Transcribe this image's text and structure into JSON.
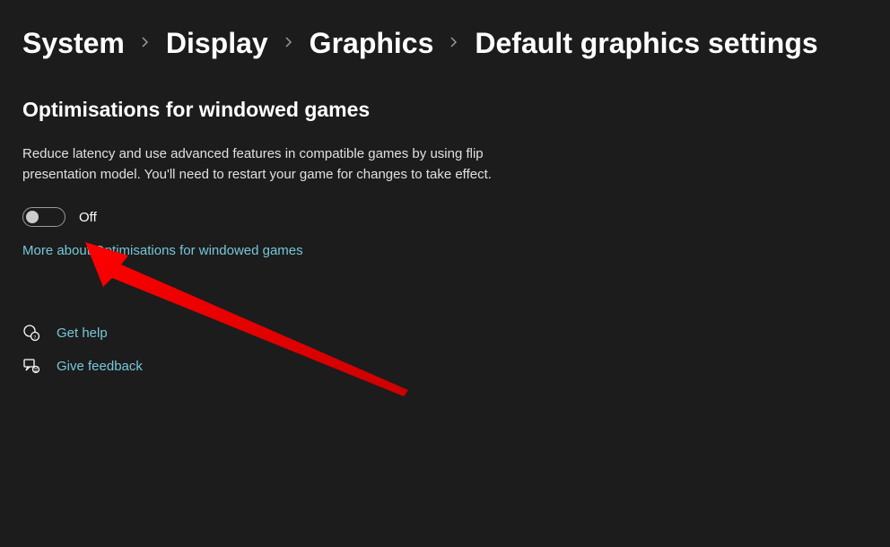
{
  "breadcrumb": {
    "items": [
      {
        "label": "System"
      },
      {
        "label": "Display"
      },
      {
        "label": "Graphics"
      }
    ],
    "current": "Default graphics settings"
  },
  "section": {
    "title": "Optimisations for windowed games",
    "description": "Reduce latency and use advanced features in compatible games by using flip presentation model. You'll need to restart your game for changes to take effect.",
    "toggle_state": "Off",
    "more_link": "More about Optimisations for windowed games"
  },
  "help": {
    "get_help": "Get help",
    "give_feedback": "Give feedback"
  }
}
